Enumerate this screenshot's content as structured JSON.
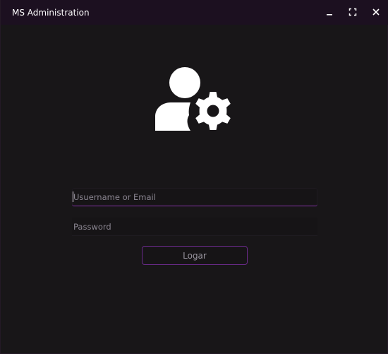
{
  "window": {
    "title": "MS Administration",
    "controls": [
      "minimize-icon",
      "maximize-icon",
      "close-icon"
    ]
  },
  "hero": {
    "icon": "user-gear-icon"
  },
  "login_form": {
    "username": {
      "placeholder": "Usuername or Email",
      "value": ""
    },
    "password": {
      "placeholder": "Password",
      "value": ""
    },
    "submit_label": "Logar"
  },
  "colors": {
    "background": "#181618",
    "titlebar": "#1c1020",
    "accent": "#7a2a9a",
    "button_border": "#6a2a8a",
    "text": "#ffffff"
  }
}
